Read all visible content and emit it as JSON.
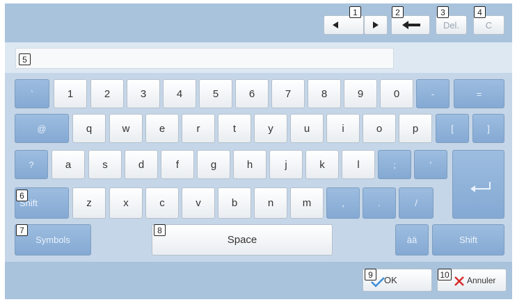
{
  "keyboard": {
    "row1": [
      "`",
      "1",
      "2",
      "3",
      "4",
      "5",
      "6",
      "7",
      "8",
      "9",
      "0",
      "-",
      "="
    ],
    "row2": [
      "@",
      "q",
      "w",
      "e",
      "r",
      "t",
      "y",
      "u",
      "i",
      "o",
      "p",
      "[",
      "]"
    ],
    "row3": [
      "?",
      "a",
      "s",
      "d",
      "f",
      "g",
      "h",
      "j",
      "k",
      "l",
      ";",
      "'"
    ],
    "row4": [
      "z",
      "x",
      "c",
      "v",
      "b",
      "n",
      "m",
      ",",
      ".",
      "/"
    ],
    "shift_label": "Shift",
    "symbols_label": "Symbols",
    "space_label": "Space",
    "accent_label": "àä"
  },
  "toolbar": {
    "delete_label": "Del.",
    "clear_label": "C"
  },
  "footer": {
    "ok_label": "OK",
    "cancel_label": "Annuler"
  },
  "callouts": [
    "1",
    "2",
    "3",
    "4",
    "5",
    "6",
    "7",
    "8",
    "9",
    "10"
  ],
  "colors": {
    "top_bar": "#a9c3dc",
    "key_area": "#c5d6e8",
    "blue_key": "#8fb2d9",
    "white_key": "#f3f5f7",
    "ok_check": "#3b8ed8",
    "cancel_x": "#d62c2c"
  }
}
